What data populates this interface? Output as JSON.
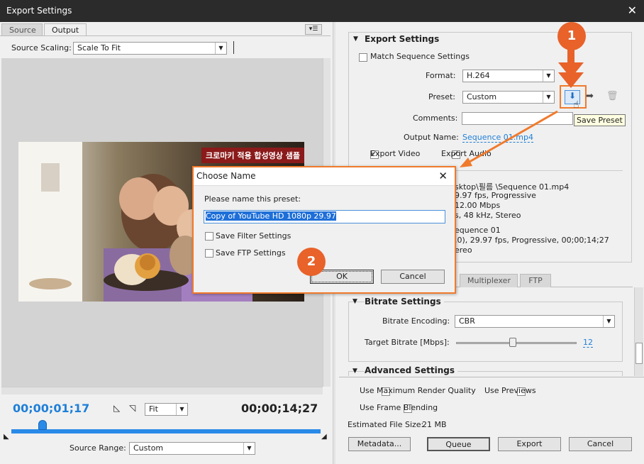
{
  "window": {
    "title": "Export Settings",
    "close": "✕"
  },
  "left": {
    "tabs": [
      "Source",
      "Output"
    ],
    "source_scaling_label": "Source Scaling:",
    "source_scaling_value": "Scale To Fit",
    "overlay_text": "크로마키 적용 합성영상 샘플",
    "current_time": "00;00;01;17",
    "duration": "00;00;14;27",
    "zoom": "Fit",
    "source_range_label": "Source Range:",
    "source_range_value": "Custom",
    "playhead_fraction": 0.1
  },
  "export": {
    "section_title": "Export Settings",
    "match_sequence": "Match Sequence Settings",
    "format_label": "Format:",
    "format_value": "H.264",
    "preset_label": "Preset:",
    "preset_value": "Custom",
    "comments_label": "Comments:",
    "output_name_label": "Output Name:",
    "output_name_value": "Sequence 01.mp4",
    "export_video": "Export Video",
    "export_audio": "Export Audio",
    "tooltip": "Save Preset",
    "summary": [
      "sktop\\필름 \\Sequence 01.mp4",
      "9.97 fps, Progressive",
      "12.00 Mbps",
      "s, 48 kHz, Stereo",
      "equence 01",
      ".0), 29.97 fps, Progressive, 00;00;14;27",
      "ereo"
    ],
    "lower_tabs": [
      "Multiplexer",
      "FTP"
    ]
  },
  "bitrate": {
    "section_title": "Bitrate Settings",
    "encoding_label": "Bitrate Encoding:",
    "encoding_value": "CBR",
    "target_label": "Target Bitrate [Mbps]:",
    "target_value": "12"
  },
  "advanced": {
    "section_title": "Advanced Settings"
  },
  "bottom": {
    "max_render": "Use Maximum Render Quality",
    "use_previews": "Use Previews",
    "frame_blending": "Use Frame Blending",
    "file_size_label": "Estimated File Size:",
    "file_size_value": "21 MB",
    "metadata": "Metadata...",
    "queue": "Queue",
    "export": "Export",
    "cancel": "Cancel"
  },
  "dialog": {
    "title": "Choose Name",
    "close": "✕",
    "prompt": "Please name this preset:",
    "name_value": "Copy of YouTube HD 1080p 29.97",
    "save_filter": "Save Filter Settings",
    "save_ftp": "Save FTP Settings",
    "ok": "OK",
    "cancel": "Cancel"
  },
  "callouts": {
    "one": "1",
    "two": "2"
  },
  "colors": {
    "accent": "#e8622a",
    "link": "#1e7fd8",
    "timeline": "#2a8ae8"
  }
}
